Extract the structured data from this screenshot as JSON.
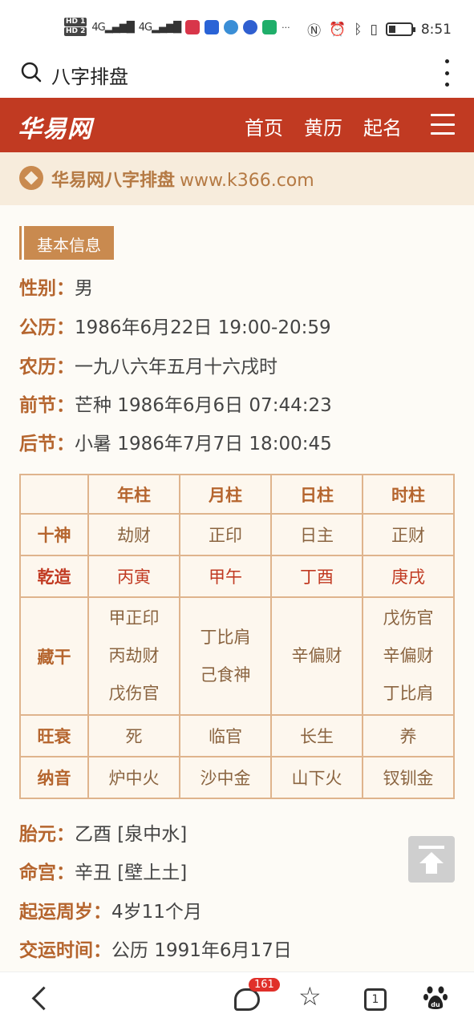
{
  "status_bar": {
    "hd1": "HD 1",
    "hd2": "HD 2",
    "signal1": "4G",
    "signal2": "4G",
    "more": "···",
    "time": "8:51"
  },
  "search_bar": {
    "query": "八字排盘"
  },
  "site_header": {
    "logo": "华易网",
    "nav": [
      "首页",
      "黄历",
      "起名"
    ]
  },
  "banner": {
    "title": "华易网八字排盘",
    "url": "www.k366.com"
  },
  "section": {
    "title": "基本信息"
  },
  "basic_info": [
    {
      "key": "性别：",
      "value": "男"
    },
    {
      "key": "公历：",
      "value": "1986年6月22日 19:00-20:59"
    },
    {
      "key": "农历：",
      "value": "一九八六年五月十六戌时"
    },
    {
      "key": "前节：",
      "value": "芒种 1986年6月6日 07:44:23"
    },
    {
      "key": "后节：",
      "value": "小暑 1986年7月7日 18:00:45"
    }
  ],
  "bazi_table": {
    "headers": [
      "",
      "年柱",
      "月柱",
      "日柱",
      "时柱"
    ],
    "shishen": {
      "label": "十神",
      "values": [
        "劫财",
        "正印",
        "日主",
        "正财"
      ]
    },
    "qianzao": {
      "label": "乾造",
      "values": [
        "丙寅",
        "甲午",
        "丁酉",
        "庚戌"
      ]
    },
    "canggan": {
      "label": "藏干",
      "values": [
        [
          "甲正印",
          "丙劫财",
          "戊伤官"
        ],
        [
          "丁比肩",
          "己食神"
        ],
        [
          "辛偏财"
        ],
        [
          "戊伤官",
          "辛偏财",
          "丁比肩"
        ]
      ]
    },
    "wangshuai": {
      "label": "旺衰",
      "values": [
        "死",
        "临官",
        "长生",
        "养"
      ]
    },
    "nayin": {
      "label": "纳音",
      "values": [
        "炉中火",
        "沙中金",
        "山下火",
        "钗钏金"
      ]
    }
  },
  "extra_info": [
    {
      "key": "胎元：",
      "value": "乙酉 [泉中水]"
    },
    {
      "key": "命宫：",
      "value": "辛丑 [壁上土]"
    },
    {
      "key": "起运周岁：",
      "value": "4岁11个月"
    },
    {
      "key": "交运时间：",
      "value": "公历 1991年6月17日"
    }
  ],
  "bottom_nav": {
    "badge": "161",
    "tabs_count": "1"
  },
  "colors": {
    "brand_red": "#c13a22",
    "accent_brown": "#c98a4f",
    "key_text": "#b5652e"
  }
}
